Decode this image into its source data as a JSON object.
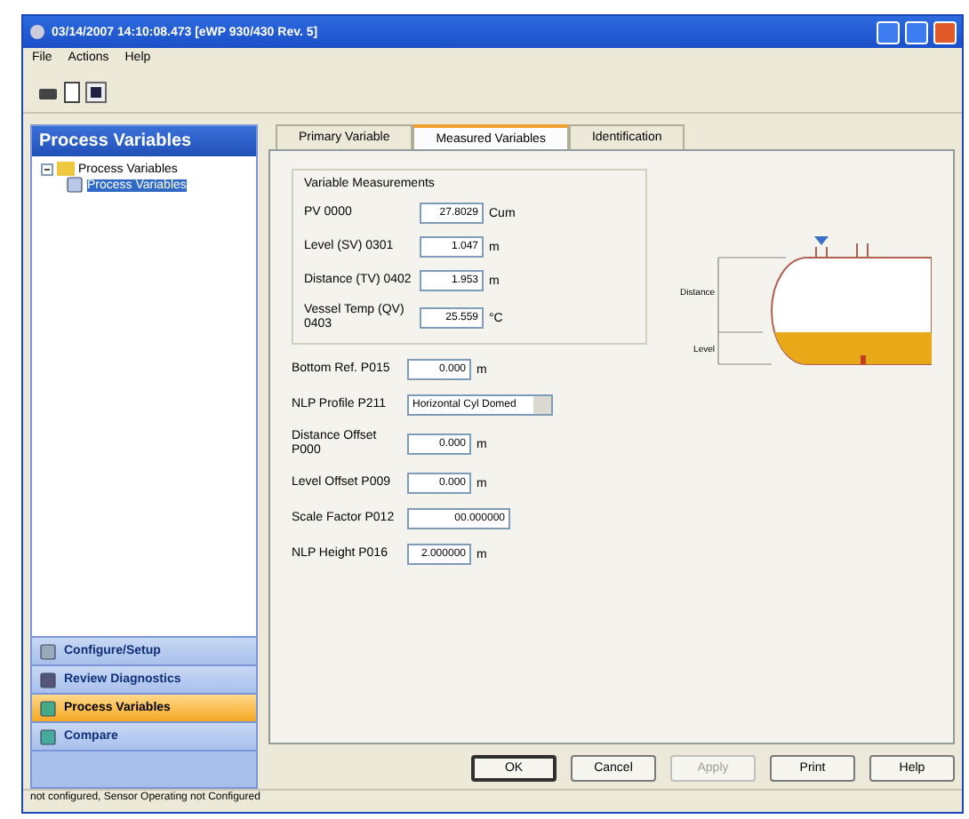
{
  "window": {
    "title": "03/14/2007 14:10:08.473 [eWP 930/430 Rev. 5]"
  },
  "menu": [
    "File",
    "Actions",
    "Help"
  ],
  "sidebar": {
    "header": "Process Variables",
    "tree": [
      {
        "label": "Process Variables",
        "expanded": true,
        "children": [
          {
            "label": "Process Variables",
            "selected": true
          }
        ]
      }
    ],
    "nav": [
      {
        "label": "Configure/Setup",
        "selected": false
      },
      {
        "label": "Review Diagnostics",
        "selected": false
      },
      {
        "label": "Process Variables",
        "selected": true
      },
      {
        "label": "Compare",
        "selected": false
      }
    ]
  },
  "tabs": [
    {
      "label": "Primary Variable",
      "selected": false
    },
    {
      "label": "Measured Variables",
      "selected": true
    },
    {
      "label": "Identification",
      "selected": false
    }
  ],
  "measurements": {
    "title": "Variable Measurements",
    "rows": [
      {
        "label": "PV 0000",
        "value": "27.8029",
        "unit": "Cum"
      },
      {
        "label": "Level (SV) 0301",
        "value": "1.047",
        "unit": "m"
      },
      {
        "label": "Distance (TV) 0402",
        "value": "1.953",
        "unit": "m"
      },
      {
        "label": "Vessel Temp (QV) 0403",
        "value": "25.559",
        "unit": "°C"
      }
    ]
  },
  "settings": [
    {
      "kind": "number",
      "label": "Bottom Ref. P015",
      "value": "0.000",
      "unit": "m"
    },
    {
      "kind": "dropdown",
      "label": "NLP Profile P211",
      "value": "Horizontal Cyl Domed"
    },
    {
      "kind": "number",
      "label": "Distance Offset P000",
      "value": "0.000",
      "unit": "m"
    },
    {
      "kind": "number",
      "label": "Level Offset P009",
      "value": "0.000",
      "unit": "m"
    },
    {
      "kind": "wide",
      "label": "Scale Factor P012",
      "value": "00.000000"
    },
    {
      "kind": "number",
      "label": "NLP Height P016",
      "value": "2.000000",
      "unit": "m"
    }
  ],
  "diagram": {
    "distance_label": "Distance",
    "level_label": "Level",
    "level": 0.3
  },
  "buttons": [
    {
      "label": "OK",
      "disabled": false
    },
    {
      "label": "Cancel",
      "disabled": false
    },
    {
      "label": "Apply",
      "disabled": true
    },
    {
      "label": "Print",
      "disabled": false
    },
    {
      "label": "Help",
      "disabled": false
    }
  ],
  "status_bar": "not configured, Sensor Operating not Configured"
}
